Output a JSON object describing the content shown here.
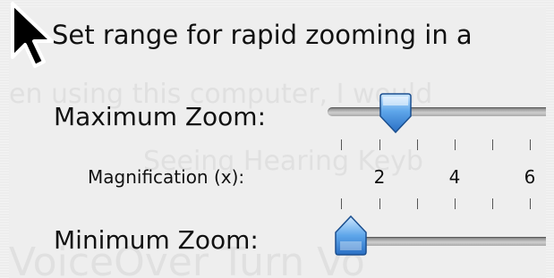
{
  "heading": "Set range for rapid zooming in a",
  "background_text": {
    "row1": "en using this computer, I would",
    "row2": "Seeing    Hearing    Keyb",
    "row3": "VoiceOver    Turn Vo"
  },
  "max_zoom": {
    "label": "Maximum Zoom:",
    "level": 0.24
  },
  "magnification": {
    "label": "Magnification (x):",
    "ticks": [
      "2",
      "4",
      "6"
    ]
  },
  "min_zoom": {
    "label": "Minimum Zoom:",
    "level": 0.0
  },
  "colors": {
    "thumb_top": "#cfe8ff",
    "thumb_mid": "#5ea6ea",
    "thumb_bottom": "#2a6fc4",
    "thumb_edge": "#1b4f8f"
  }
}
